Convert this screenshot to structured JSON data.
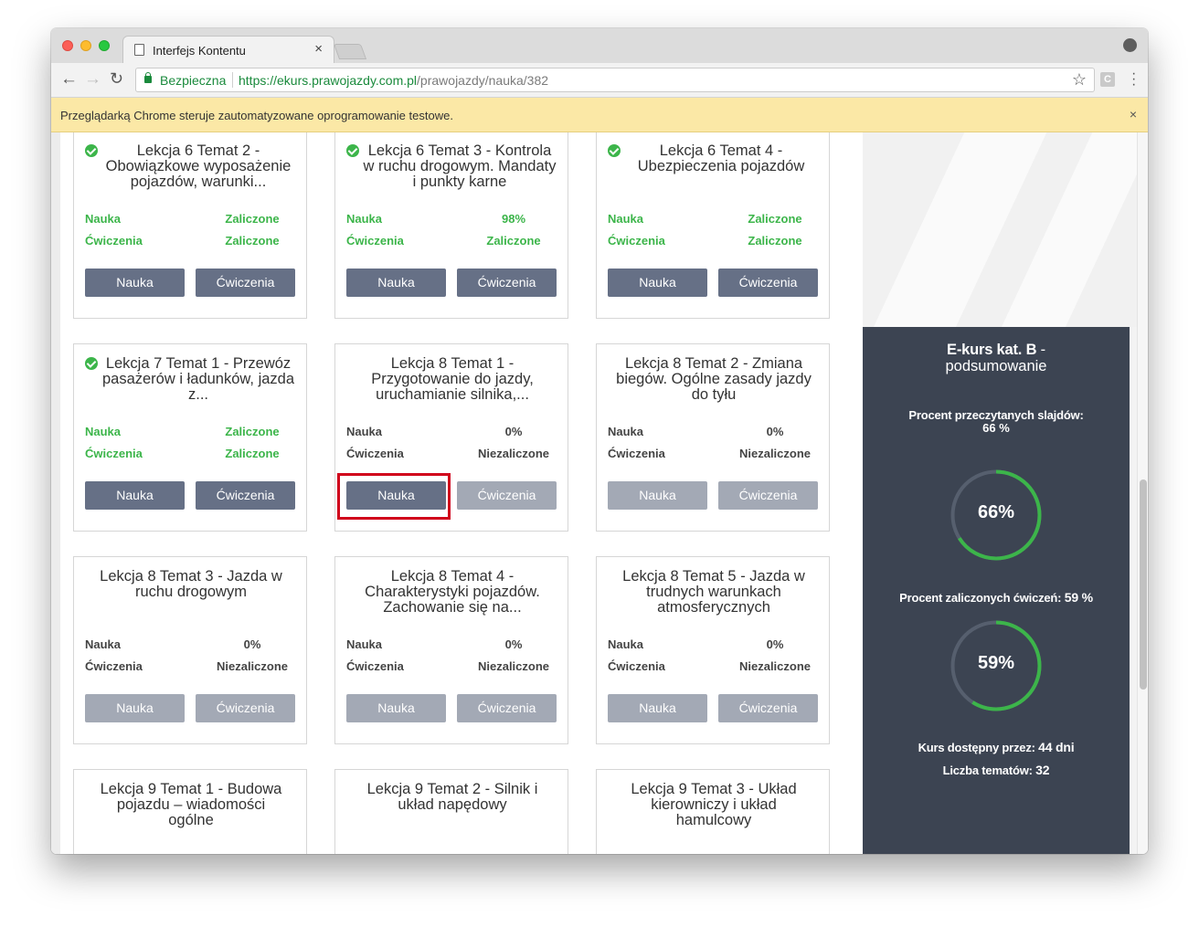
{
  "browser": {
    "tab_title": "Interfejs Kontentu",
    "tab_close": "×",
    "secure_label": "Bezpieczna",
    "url_host": "https://ekurs.prawojazdy.com.pl",
    "url_path": "/prawojazdy/nauka/382",
    "ext_label": "C",
    "infobar_text": "Przeglądarką Chrome steruje zautomatyzowane oprogramowanie testowe.",
    "infobar_close": "×"
  },
  "lessons": [
    {
      "title": "Lekcja 6 Temat 2 - Obowiązkowe wyposażenie pojazdów, warunki...",
      "completed": true,
      "nauka_label": "Nauka",
      "nauka_value": "Zaliczone",
      "cwiczenia_label": "Ćwiczenia",
      "cwiczenia_value": "Zaliczone",
      "btn_nauka": "Nauka",
      "btn_cwiczenia": "Ćwiczenia"
    },
    {
      "title": "Lekcja 6 Temat 3 - Kontrola w ruchu drogowym. Mandaty i punkty karne",
      "completed": true,
      "nauka_label": "Nauka",
      "nauka_value": "98%",
      "cwiczenia_label": "Ćwiczenia",
      "cwiczenia_value": "Zaliczone",
      "btn_nauka": "Nauka",
      "btn_cwiczenia": "Ćwiczenia"
    },
    {
      "title": "Lekcja 6 Temat 4 - Ubezpieczenia pojazdów",
      "completed": true,
      "nauka_label": "Nauka",
      "nauka_value": "Zaliczone",
      "cwiczenia_label": "Ćwiczenia",
      "cwiczenia_value": "Zaliczone",
      "btn_nauka": "Nauka",
      "btn_cwiczenia": "Ćwiczenia"
    },
    {
      "title": "Lekcja 7 Temat 1 - Przewóz pasażerów i ładunków, jazda z...",
      "completed": true,
      "nauka_label": "Nauka",
      "nauka_value": "Zaliczone",
      "cwiczenia_label": "Ćwiczenia",
      "cwiczenia_value": "Zaliczone",
      "btn_nauka": "Nauka",
      "btn_cwiczenia": "Ćwiczenia"
    },
    {
      "title": "Lekcja 8 Temat 1 - Przygotowanie do jazdy, uruchamianie silnika,...",
      "completed": false,
      "nauka_label": "Nauka",
      "nauka_value": "0%",
      "cwiczenia_label": "Ćwiczenia",
      "cwiczenia_value": "Niezaliczone",
      "btn_nauka": "Nauka",
      "btn_cwiczenia": "Ćwiczenia"
    },
    {
      "title": "Lekcja 8 Temat 2 - Zmiana biegów. Ogólne zasady jazdy do tyłu",
      "completed": false,
      "nauka_label": "Nauka",
      "nauka_value": "0%",
      "cwiczenia_label": "Ćwiczenia",
      "cwiczenia_value": "Niezaliczone",
      "btn_nauka": "Nauka",
      "btn_cwiczenia": "Ćwiczenia"
    },
    {
      "title": "Lekcja 8 Temat 3 - Jazda w ruchu drogowym",
      "completed": false,
      "nauka_label": "Nauka",
      "nauka_value": "0%",
      "cwiczenia_label": "Ćwiczenia",
      "cwiczenia_value": "Niezaliczone",
      "btn_nauka": "Nauka",
      "btn_cwiczenia": "Ćwiczenia"
    },
    {
      "title": "Lekcja 8 Temat 4 - Charakterystyki pojazdów. Zachowanie się na...",
      "completed": false,
      "nauka_label": "Nauka",
      "nauka_value": "0%",
      "cwiczenia_label": "Ćwiczenia",
      "cwiczenia_value": "Niezaliczone",
      "btn_nauka": "Nauka",
      "btn_cwiczenia": "Ćwiczenia"
    },
    {
      "title": "Lekcja 8 Temat 5 - Jazda w trudnych warunkach atmosferycznych",
      "completed": false,
      "nauka_label": "Nauka",
      "nauka_value": "0%",
      "cwiczenia_label": "Ćwiczenia",
      "cwiczenia_value": "Niezaliczone",
      "btn_nauka": "Nauka",
      "btn_cwiczenia": "Ćwiczenia"
    },
    {
      "title": "Lekcja 9 Temat 1 - Budowa pojazdu – wiadomości ogólne"
    },
    {
      "title": "Lekcja 9 Temat 2 - Silnik i układ napędowy"
    },
    {
      "title": "Lekcja 9 Temat 3 - Układ kierowniczy i układ hamulcowy"
    }
  ],
  "summary": {
    "title_bold": "E-kurs kat. B",
    "title_dash": " -",
    "subtitle": "podsumowanie",
    "slides_label": "Procent przeczytanych slajdów:",
    "slides_value": "66 %",
    "slides_gauge_text": "66%",
    "slides_fraction": 0.66,
    "exercises_label": "Procent zaliczonych ćwiczeń:",
    "exercises_value": "59 %",
    "exercises_gauge_text": "59%",
    "exercises_fraction": 0.59,
    "available_label": "Kurs dostępny przez:",
    "available_value": "44 dni",
    "topics_label": "Liczba tematów:",
    "topics_value": "32"
  },
  "colors": {
    "green": "#3cb54a",
    "button": "#667086",
    "button_disabled": "#a3a9b5",
    "sidebar": "#3c4452",
    "gauge_track": "#565f6e",
    "highlight": "#d0021b"
  }
}
